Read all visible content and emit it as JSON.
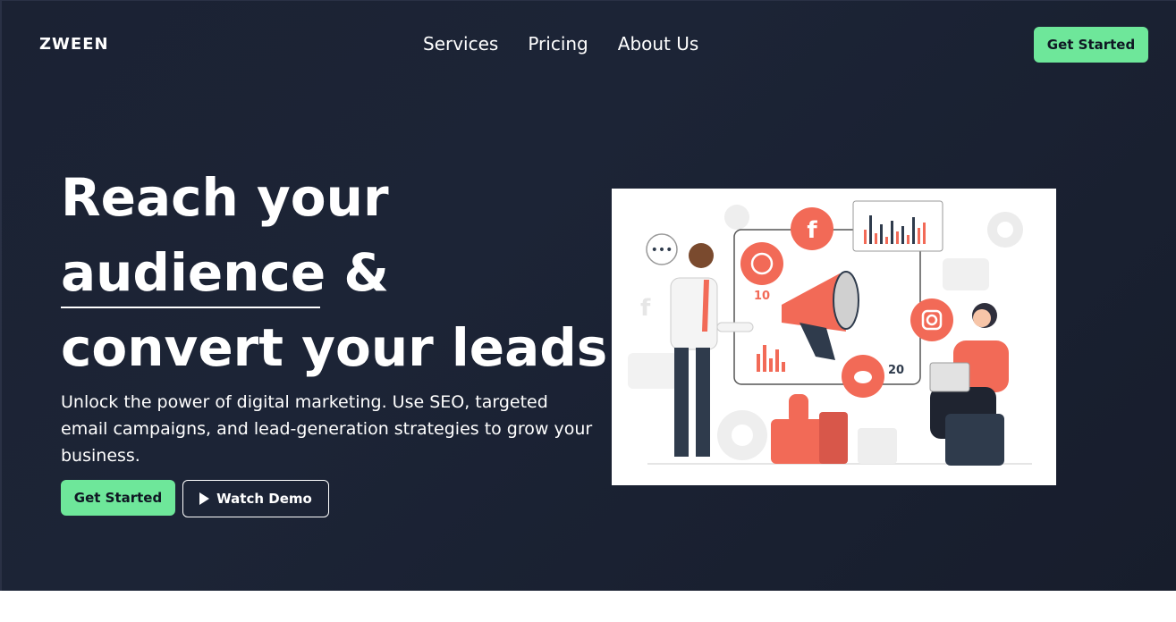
{
  "brand": {
    "logo": "ZWEEN"
  },
  "nav": {
    "items": [
      "Services",
      "Pricing",
      "About Us"
    ]
  },
  "header": {
    "cta_label": "Get Started"
  },
  "hero": {
    "headline_lines": [
      "Reach your",
      "audience &",
      "convert your leads"
    ],
    "description": "Unlock the power of digital marketing. Use SEO, targeted email campaigns, and lead-generation strategies to grow your business.",
    "primary_cta": "Get Started",
    "secondary_cta": "Watch Demo"
  },
  "illustration": {
    "badges": [
      "10",
      "20"
    ],
    "icons": [
      "facebook-icon",
      "whatsapp-icon",
      "instagram-icon",
      "twitter-icon",
      "megaphone-icon",
      "thumbs-up-icon",
      "chat-bubble-icon",
      "laptop-icon"
    ]
  },
  "colors": {
    "accent": "#6ee79a",
    "hero_bg": "#1b2233",
    "illustration_red": "#f26a57"
  }
}
